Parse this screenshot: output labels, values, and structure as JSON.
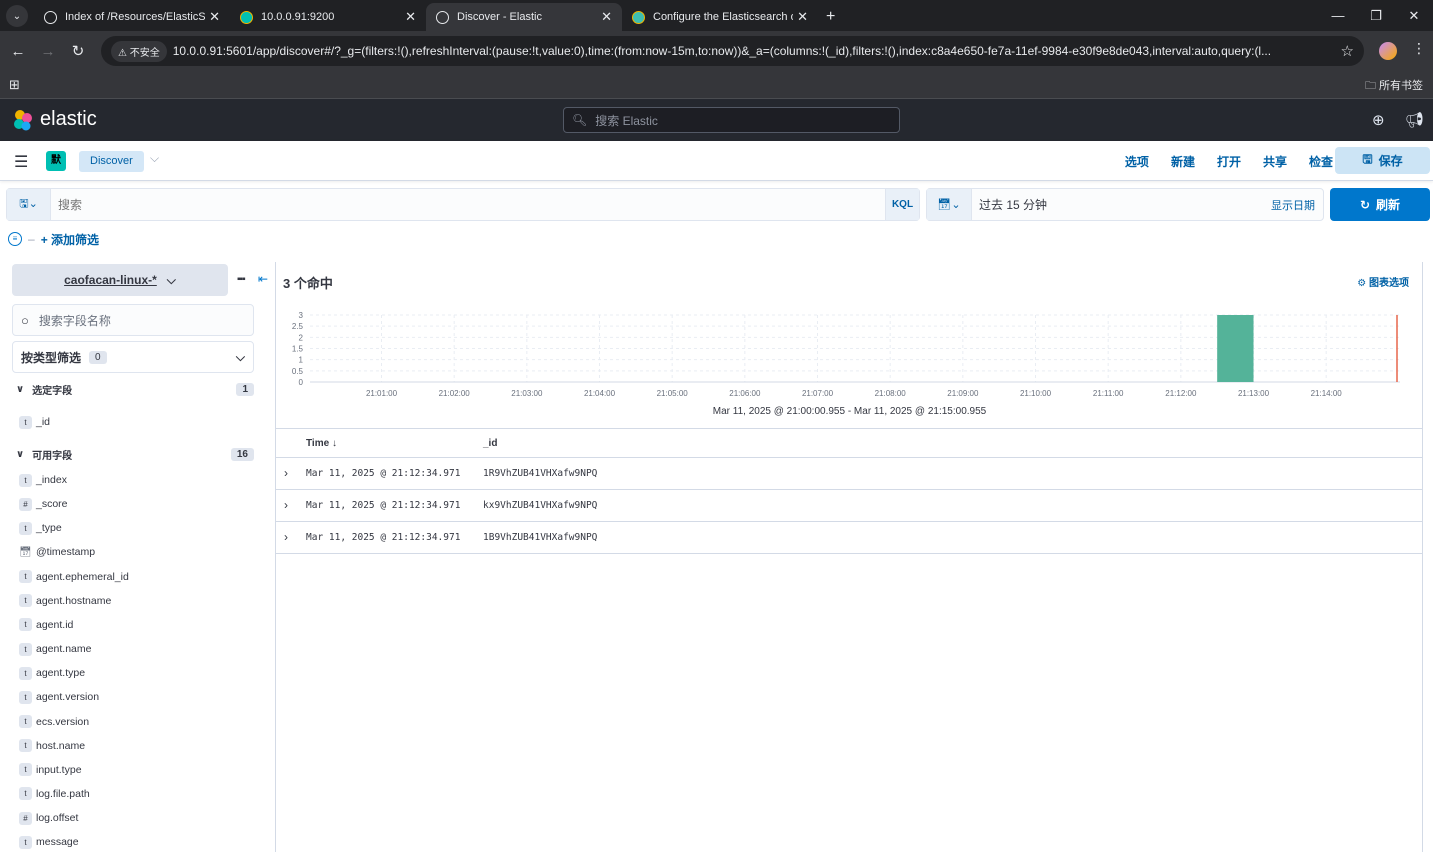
{
  "browser": {
    "tabs": [
      {
        "title": "Index of /Resources/ElasticSt",
        "active": false
      },
      {
        "title": "10.0.0.91:9200",
        "active": false
      },
      {
        "title": "Discover - Elastic",
        "active": true
      },
      {
        "title": "Configure the Elasticsearch o",
        "active": false
      }
    ],
    "insecure_label": "不安全",
    "url": "10.0.0.91:5601/app/discover#/?_g=(filters:!(),refreshInterval:(pause:!t,value:0),time:(from:now-15m,to:now))&_a=(columns:!(_id),filters:!(),index:c8a4e650-fe7a-11ef-9984-e30f9e8de043,interval:auto,query:(l...",
    "bookmarks_label": "所有书签"
  },
  "kibana": {
    "brand": "elastic",
    "global_search_placeholder": "搜索 Elastic",
    "space_initial": "默",
    "breadcrumb": "Discover",
    "top_nav": [
      "选项",
      "新建",
      "打开",
      "共享",
      "检查"
    ],
    "save_label": "保存",
    "query_placeholder": "搜索",
    "query_language": "KQL",
    "time_label": "过去 15 分钟",
    "show_dates": "显示日期",
    "refresh_label": "刷新",
    "add_filter": "+ 添加筛选"
  },
  "sidebar": {
    "index_pattern": "caofacan-linux-*",
    "field_search_placeholder": "搜索字段名称",
    "type_filter_label": "按类型筛选",
    "type_filter_count": "0",
    "selected_header": "选定字段",
    "selected_count": "1",
    "selected_fields": [
      {
        "type": "t",
        "name": "_id"
      }
    ],
    "available_header": "可用字段",
    "available_count": "16",
    "available_fields": [
      {
        "type": "t",
        "name": "_index"
      },
      {
        "type": "#",
        "name": "_score"
      },
      {
        "type": "t",
        "name": "_type"
      },
      {
        "type": "date",
        "name": "@timestamp"
      },
      {
        "type": "t",
        "name": "agent.ephemeral_id"
      },
      {
        "type": "t",
        "name": "agent.hostname"
      },
      {
        "type": "t",
        "name": "agent.id"
      },
      {
        "type": "t",
        "name": "agent.name"
      },
      {
        "type": "t",
        "name": "agent.type"
      },
      {
        "type": "t",
        "name": "agent.version"
      },
      {
        "type": "t",
        "name": "ecs.version"
      },
      {
        "type": "t",
        "name": "host.name"
      },
      {
        "type": "t",
        "name": "input.type"
      },
      {
        "type": "t",
        "name": "log.file.path"
      },
      {
        "type": "#",
        "name": "log.offset"
      },
      {
        "type": "t",
        "name": "message"
      }
    ]
  },
  "main": {
    "hits_label": "3 个命中",
    "chart_options": "图表选项",
    "time_range": "Mar 11, 2025 @ 21:00:00.955 - Mar 11, 2025 @ 21:15:00.955",
    "columns": [
      "Time ↓",
      "_id"
    ],
    "rows": [
      {
        "time": "Mar 11, 2025 @ 21:12:34.971",
        "id": "1R9VhZUB41VHXafw9NPQ"
      },
      {
        "time": "Mar 11, 2025 @ 21:12:34.971",
        "id": "kx9VhZUB41VHXafw9NPQ"
      },
      {
        "time": "Mar 11, 2025 @ 21:12:34.971",
        "id": "1B9VhZUB41VHXafw9NPQ"
      }
    ]
  },
  "chart_data": {
    "type": "bar",
    "categories": [
      "21:01:00",
      "21:02:00",
      "21:03:00",
      "21:04:00",
      "21:05:00",
      "21:06:00",
      "21:07:00",
      "21:08:00",
      "21:09:00",
      "21:10:00",
      "21:11:00",
      "21:12:00",
      "21:13:00",
      "21:14:00"
    ],
    "x_ticks": [
      "21:01:00",
      "21:02:00",
      "21:03:00",
      "21:04:00",
      "21:05:00",
      "21:06:00",
      "21:07:00",
      "21:08:00",
      "21:09:00",
      "21:10:00",
      "21:11:00",
      "21:12:00",
      "21:13:00",
      "21:14:00"
    ],
    "y_ticks": [
      "3",
      "2.5",
      "2",
      "1.5",
      "1",
      "0.5",
      "0"
    ],
    "bars": [
      {
        "start": "21:12:30",
        "end": "21:13:00",
        "value": 3
      }
    ],
    "ylim": [
      0,
      3
    ],
    "bar_color": "#54b399",
    "now_marker_color": "#e7664c",
    "grid": true
  }
}
